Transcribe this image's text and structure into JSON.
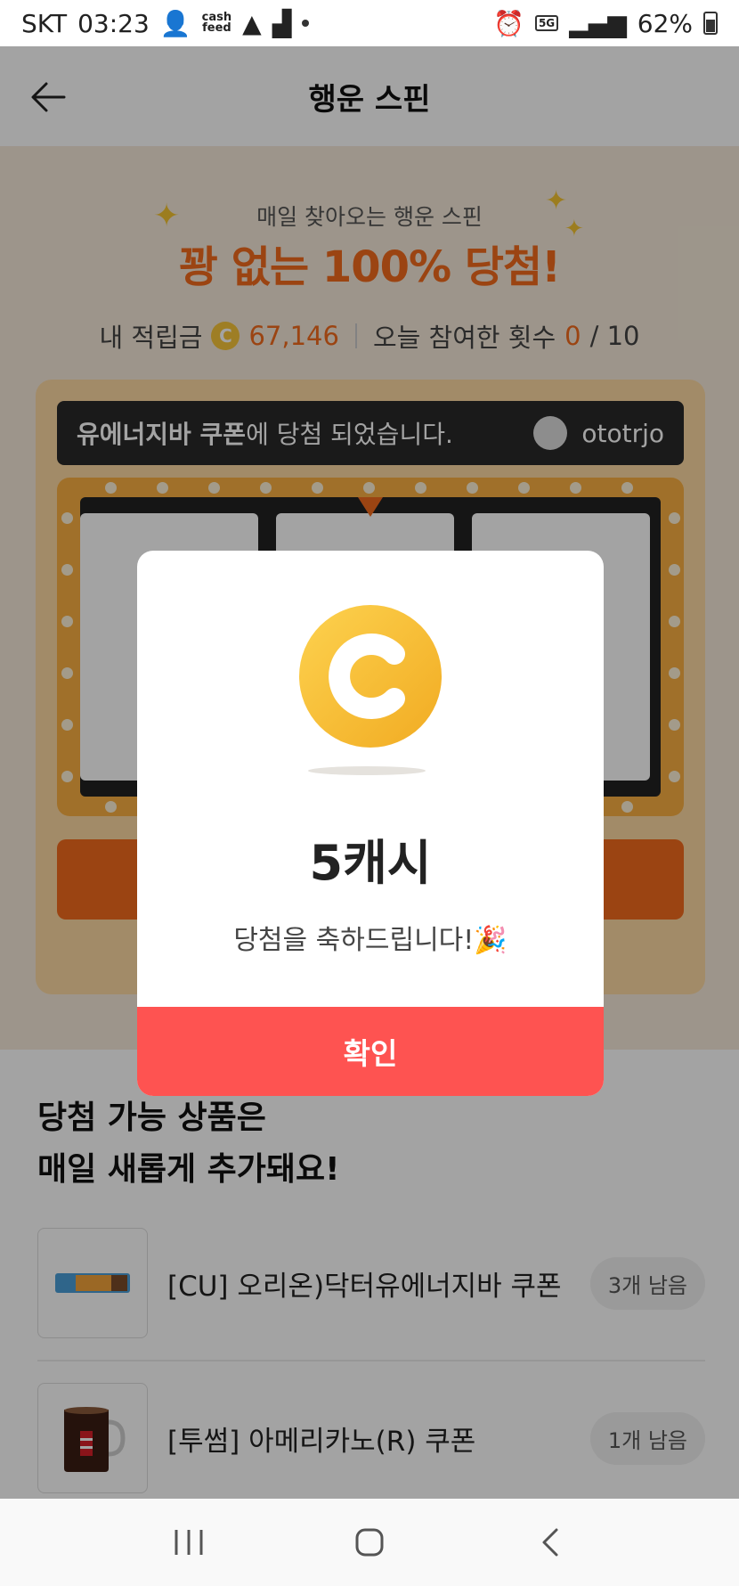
{
  "status_bar": {
    "carrier": "SKT",
    "time": "03:23",
    "app_badge_line1": "cash",
    "app_badge_line2": "feed",
    "network": "5G",
    "battery": "62%"
  },
  "header": {
    "title": "행운 스핀"
  },
  "banner": {
    "subtitle": "매일 찾아오는 행운 스핀",
    "headline": "꽝 없는 100% 당첨!",
    "points_label": "내 적립금",
    "coin_glyph": "C",
    "points_value": "67,146",
    "attempts_label": "오늘 참여한 횟수",
    "attempts_used": "0",
    "attempts_total": "/ 10"
  },
  "ticker": {
    "prize_bold": "유에너지바 쿠폰",
    "text": "에 당첨 되었습니다.",
    "user": "ototrjo"
  },
  "list": {
    "heading_line1": "당첨 가능 상품은",
    "heading_line2": "매일 새롭게 추가돼요!",
    "items": [
      {
        "label": "[CU] 오리온)닥터유에너지바 쿠폰",
        "remaining": "3개 남음"
      },
      {
        "label": "[투썸] 아메리카노(R) 쿠폰",
        "remaining": "1개 남음"
      }
    ]
  },
  "modal": {
    "prize": "5캐시",
    "message": "당첨을 축하드립니다!🎉",
    "confirm_label": "확인"
  },
  "colors": {
    "accent_orange": "#f26b1d",
    "confirm_red": "#fe5351",
    "coin_yellow": "#f8c53a"
  }
}
